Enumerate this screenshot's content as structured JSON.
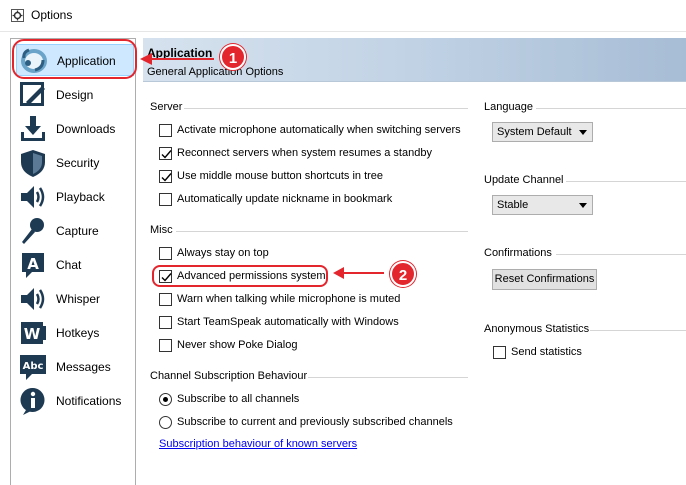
{
  "window": {
    "title": "Options"
  },
  "sidebar": {
    "items": [
      {
        "label": "Application",
        "icon": "teamspeak-logo-icon",
        "active": true
      },
      {
        "label": "Design",
        "icon": "pencil-icon"
      },
      {
        "label": "Downloads",
        "icon": "download-icon"
      },
      {
        "label": "Security",
        "icon": "shield-icon"
      },
      {
        "label": "Playback",
        "icon": "speaker-icon"
      },
      {
        "label": "Capture",
        "icon": "microphone-icon"
      },
      {
        "label": "Chat",
        "icon": "chat-a-icon"
      },
      {
        "label": "Whisper",
        "icon": "whisper-speaker-icon"
      },
      {
        "label": "Hotkeys",
        "icon": "hotkeys-w-icon"
      },
      {
        "label": "Messages",
        "icon": "abc-icon"
      },
      {
        "label": "Notifications",
        "icon": "info-icon"
      }
    ]
  },
  "header": {
    "title": "Application",
    "subtitle": "General Application Options"
  },
  "server": {
    "title": "Server",
    "options": [
      {
        "label": "Activate microphone automatically when switching servers",
        "checked": false
      },
      {
        "label": "Reconnect servers when system resumes a standby",
        "checked": true
      },
      {
        "label": "Use middle mouse button shortcuts in tree",
        "checked": true
      },
      {
        "label": "Automatically update nickname in bookmark",
        "checked": false
      }
    ]
  },
  "misc": {
    "title": "Misc",
    "options": [
      {
        "label": "Always stay on top",
        "checked": false
      },
      {
        "label": "Advanced permissions system",
        "checked": true
      },
      {
        "label": "Warn when talking while microphone is muted",
        "checked": false
      },
      {
        "label": "Start TeamSpeak automatically with Windows",
        "checked": false
      },
      {
        "label": "Never show Poke Dialog",
        "checked": false
      }
    ]
  },
  "channel_subscription": {
    "title": "Channel Subscription Behaviour",
    "options": [
      {
        "label": "Subscribe to all channels",
        "selected": true
      },
      {
        "label": "Subscribe to current and previously subscribed channels",
        "selected": false
      }
    ],
    "link": "Subscription behaviour of known servers"
  },
  "language": {
    "title": "Language",
    "value": "System Default"
  },
  "update_channel": {
    "title": "Update Channel",
    "value": "Stable"
  },
  "confirmations": {
    "title": "Confirmations",
    "button": "Reset Confirmations"
  },
  "anonymous_statistics": {
    "title": "Anonymous Statistics",
    "option": "Send statistics",
    "checked": false
  },
  "annotations": [
    {
      "number": "1"
    },
    {
      "number": "2"
    }
  ],
  "colors": {
    "annotation": "#e3262e",
    "header_band": "#b7c9dd",
    "active_item": "#cde8ff",
    "link": "#0000ee"
  }
}
